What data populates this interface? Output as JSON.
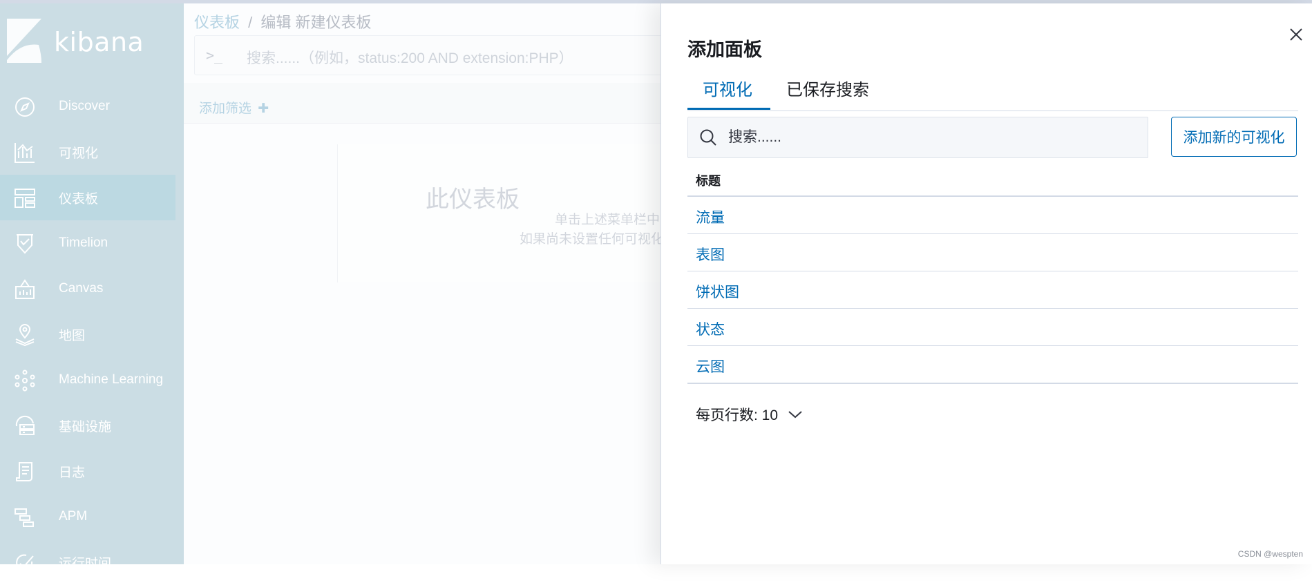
{
  "brand": {
    "name": "kibana"
  },
  "sidebar": {
    "items": [
      {
        "label": "Discover",
        "icon": "compass-icon",
        "active": false
      },
      {
        "label": "可视化",
        "icon": "visualize-icon",
        "active": false
      },
      {
        "label": "仪表板",
        "icon": "dashboard-icon",
        "active": true
      },
      {
        "label": "Timelion",
        "icon": "timelion-icon",
        "active": false
      },
      {
        "label": "Canvas",
        "icon": "canvas-icon",
        "active": false
      },
      {
        "label": "地图",
        "icon": "map-icon",
        "active": false
      },
      {
        "label": "Machine Learning",
        "icon": "machine-learning-icon",
        "active": false
      },
      {
        "label": "基础设施",
        "icon": "infrastructure-icon",
        "active": false
      },
      {
        "label": "日志",
        "icon": "logs-icon",
        "active": false
      },
      {
        "label": "APM",
        "icon": "apm-icon",
        "active": false
      },
      {
        "label": "运行时间",
        "icon": "uptime-icon",
        "active": false
      }
    ]
  },
  "main": {
    "breadcrumb": {
      "link": "仪表板",
      "separator": "/",
      "current": "编辑 新建仪表板"
    },
    "query": {
      "prompt": ">_",
      "placeholder": "搜索......（例如，status:200 AND extension:PHP）"
    },
    "filter": {
      "add_label": "添加筛选",
      "add_symbol": "✚"
    },
    "empty": {
      "title": "此仪表板",
      "line1": "单击上述菜单栏中",
      "line2": "如果尚未设置任何可视化"
    }
  },
  "flyout": {
    "title": "添加面板",
    "close_icon": "close-icon",
    "tabs": [
      {
        "label": "可视化",
        "active": true
      },
      {
        "label": "已保存搜索",
        "active": false
      }
    ],
    "search": {
      "placeholder": "搜索......",
      "value": ""
    },
    "add_button": "添加新的可视化",
    "table": {
      "header": "标题",
      "rows": [
        "流量",
        "表图",
        "饼状图",
        "状态",
        "云图"
      ]
    },
    "pager": {
      "label": "每页行数: 10"
    }
  },
  "colors": {
    "accent": "#006bb4",
    "sidebar_bg": "#cbdde4",
    "text": "#1a1c21",
    "border": "#d3dae6"
  },
  "watermark": "CSDN @wespten"
}
